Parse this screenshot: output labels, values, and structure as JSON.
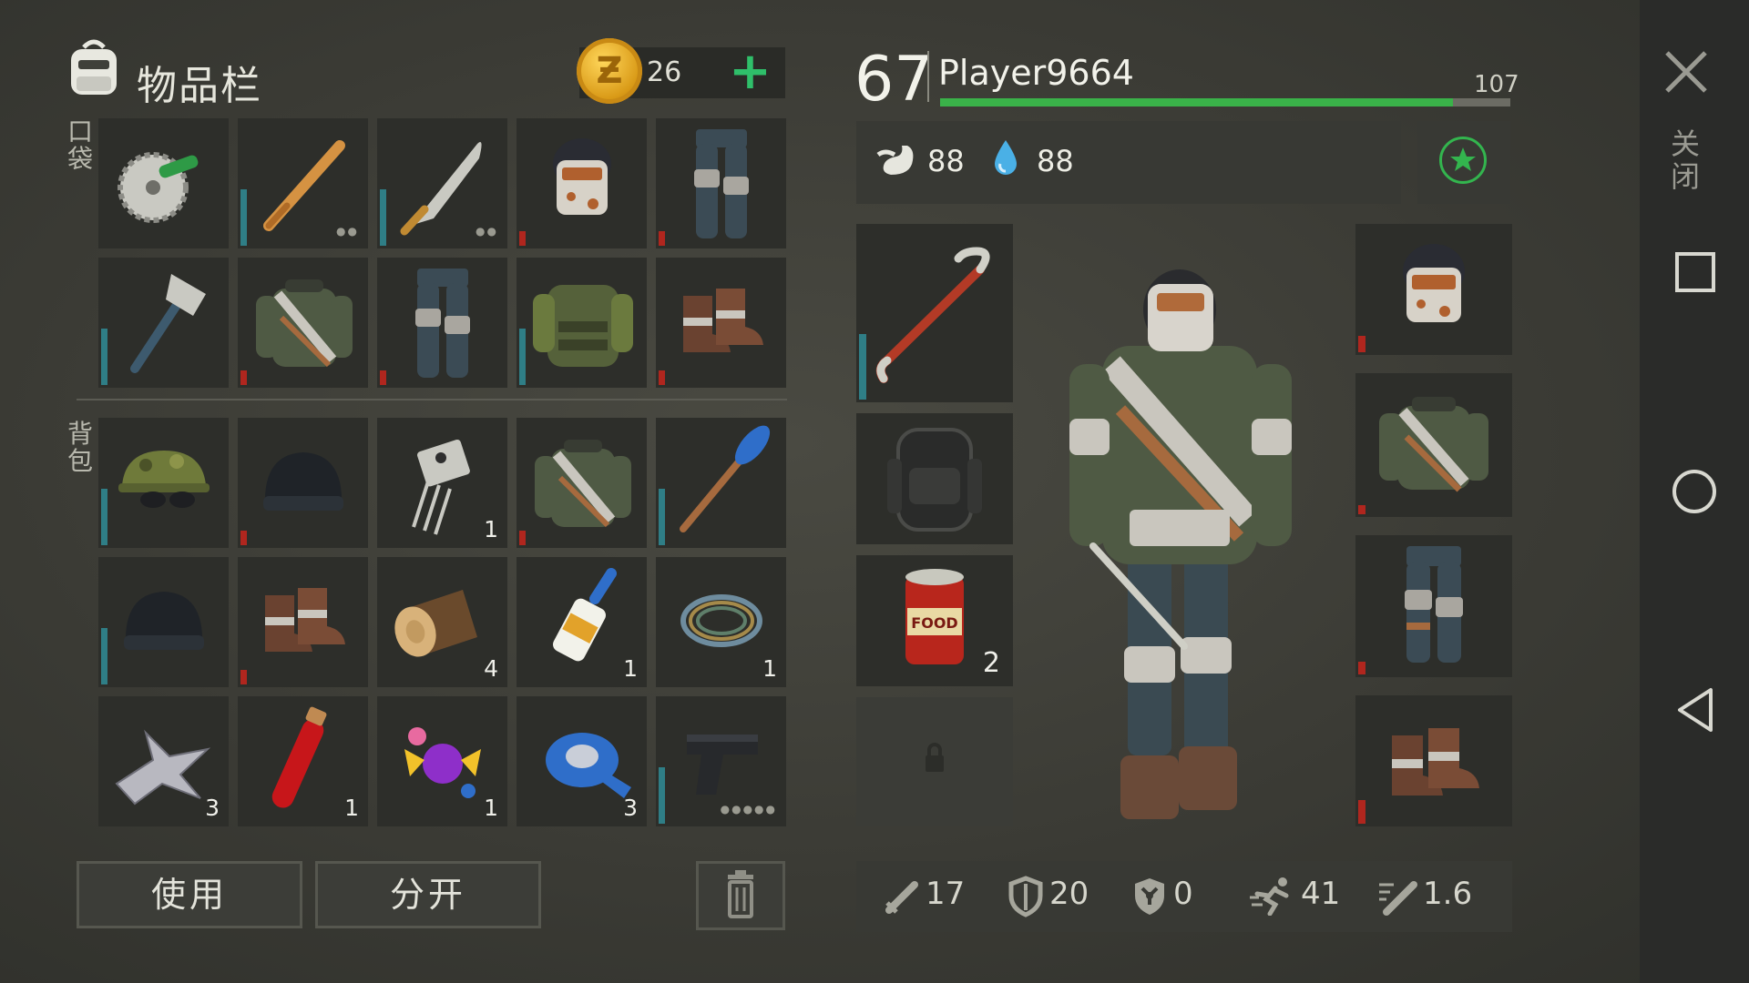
{
  "header": {
    "title": "物品栏",
    "coins": "26",
    "add_label": "+"
  },
  "labels": {
    "pockets": "口袋",
    "backpack": "背包"
  },
  "pockets": [
    {
      "item": "circular-saw",
      "qty": "",
      "bar": "none",
      "dots": ""
    },
    {
      "item": "baseball-bat",
      "qty": "",
      "bar": "blue",
      "dots": "●●"
    },
    {
      "item": "machete",
      "qty": "",
      "bar": "blue",
      "dots": "●●"
    },
    {
      "item": "welding-helmet",
      "qty": "",
      "bar": "red",
      "dots": ""
    },
    {
      "item": "armored-pants",
      "qty": "",
      "bar": "red",
      "dots": ""
    },
    {
      "item": "hatchet",
      "qty": "",
      "bar": "blue",
      "dots": ""
    },
    {
      "item": "armored-jacket",
      "qty": "",
      "bar": "red",
      "dots": ""
    },
    {
      "item": "armored-pants",
      "qty": "",
      "bar": "red",
      "dots": ""
    },
    {
      "item": "military-vest",
      "qty": "",
      "bar": "blue",
      "dots": ""
    },
    {
      "item": "leather-boots",
      "qty": "",
      "bar": "red",
      "dots": ""
    }
  ],
  "backpack": [
    {
      "item": "camo-cap-sunglasses",
      "qty": "",
      "bar": "blue",
      "dots": ""
    },
    {
      "item": "beanie",
      "qty": "",
      "bar": "red",
      "dots": ""
    },
    {
      "item": "transistor",
      "qty": "1",
      "bar": "none",
      "dots": ""
    },
    {
      "item": "armored-jacket",
      "qty": "",
      "bar": "red",
      "dots": ""
    },
    {
      "item": "oar",
      "qty": "",
      "bar": "blue",
      "dots": ""
    },
    {
      "item": "beanie",
      "qty": "",
      "bar": "blue",
      "dots": ""
    },
    {
      "item": "leather-boots",
      "qty": "",
      "bar": "red",
      "dots": ""
    },
    {
      "item": "log",
      "qty": "4",
      "bar": "none",
      "dots": ""
    },
    {
      "item": "super-glue",
      "qty": "1",
      "bar": "none",
      "dots": ""
    },
    {
      "item": "wire-coil",
      "qty": "1",
      "bar": "none",
      "dots": ""
    },
    {
      "item": "scrap-metal",
      "qty": "3",
      "bar": "none",
      "dots": ""
    },
    {
      "item": "blood-vial",
      "qty": "1",
      "bar": "none",
      "dots": ""
    },
    {
      "item": "candy",
      "qty": "1",
      "bar": "none",
      "dots": ""
    },
    {
      "item": "duct-tape",
      "qty": "3",
      "bar": "none",
      "dots": ""
    },
    {
      "item": "pistol",
      "qty": "",
      "bar": "blue",
      "dots": "●●●●●"
    }
  ],
  "buttons": {
    "use": "使用",
    "split": "分开"
  },
  "player": {
    "level": "67",
    "name": "Player9664",
    "xp_max": "107",
    "xp_fraction": 0.9,
    "hunger": "88",
    "thirst": "88"
  },
  "equipment": {
    "weapon": {
      "item": "crowbar",
      "qty": "",
      "bar": "blue"
    },
    "backpack": {
      "item": "backpack",
      "qty": "",
      "bar": "none"
    },
    "food": {
      "item": "canned-food",
      "qty": "2",
      "bar": "none"
    },
    "locked": {
      "item": "lock",
      "qty": "",
      "bar": "none"
    },
    "head": {
      "item": "welding-helmet",
      "qty": "",
      "bar": "red"
    },
    "body": {
      "item": "armored-jacket",
      "qty": "",
      "bar": "red"
    },
    "legs": {
      "item": "armored-pants",
      "qty": "",
      "bar": "red"
    },
    "feet": {
      "item": "leather-boots",
      "qty": "",
      "bar": "red"
    }
  },
  "combat_stats": {
    "attack": "17",
    "defense": "20",
    "radiation": "0",
    "speed": "41",
    "attack_speed": "1.6"
  },
  "nav": {
    "close_label": "关闭"
  },
  "colors": {
    "xp_green": "#3ab249",
    "durability_blue": "#2f7e86",
    "durability_red": "#b0261e",
    "coin_gold": "#f2b630",
    "plus_green": "#2fbf6a"
  }
}
